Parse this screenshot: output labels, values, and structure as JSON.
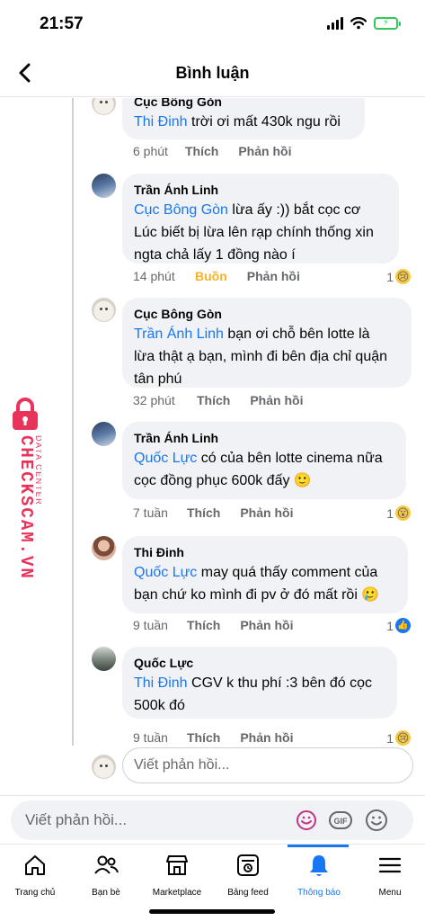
{
  "status_bar": {
    "time": "21:57"
  },
  "header": {
    "title": "Bình luận"
  },
  "comments": [
    {
      "author": "Cục Bông Gòn",
      "mention": "Thi Đinh",
      "lines": [
        " trời ơi mất 430k ngu rồi"
      ],
      "time": "6 phút",
      "reaction_label": "Thích",
      "reply_label": "Phản hồi"
    },
    {
      "author": "Trần Ánh Linh",
      "mention": "Cục Bông Gòn",
      "lines": [
        " lừa ấy :)) bắt cọc cơ",
        "Lúc biết bị lừa lên rạp chính thống xin",
        "ngta chả lấy 1 đồng nào í"
      ],
      "time": "14 phút",
      "reaction_label": "Buồn",
      "reply_label": "Phản hồi",
      "reaction_count": "1",
      "reaction_icon": "sad-emoji-icon"
    },
    {
      "author": "Cục Bông Gòn",
      "mention": "Trần Ánh Linh",
      "lines": [
        " bạn ơi chỗ bên lotte là",
        "lừa thật ạ bạn, mình đi bên địa chỉ quận",
        "tân phú"
      ],
      "time": "32 phút",
      "reaction_label": "Thích",
      "reply_label": "Phản hồi"
    },
    {
      "author": "Trần Ánh Linh",
      "mention": "Quốc Lực",
      "lines": [
        " có của bên lotte cinema nữa",
        "cọc đồng phục 600k đấy 🙂"
      ],
      "time": "7 tuần",
      "reaction_label": "Thích",
      "reply_label": "Phản hồi",
      "reaction_count": "1",
      "reaction_icon": "wow-emoji-icon"
    },
    {
      "author": "Thi Đinh",
      "mention": "Quốc Lực",
      "lines": [
        " may quá thấy comment của",
        "bạn chứ ko mình đi pv ở đó mất rồi 🥲"
      ],
      "time": "9 tuần",
      "reaction_label": "Thích",
      "reply_label": "Phản hồi",
      "reaction_count": "1",
      "reaction_icon": "like-icon"
    },
    {
      "author": "Quốc Lực",
      "mention": "Thi Đinh",
      "lines": [
        " CGV k thu phí :3 bên đó cọc",
        "500k đó"
      ],
      "time": "9 tuần",
      "reaction_label": "Thích",
      "reply_label": "Phản hồi",
      "reaction_count": "1",
      "reaction_icon": "sad-emoji-icon"
    }
  ],
  "inline_reply": {
    "placeholder": "Viết phản hồi..."
  },
  "composer": {
    "placeholder": "Viết phản hồi...",
    "gif_label": "GIF"
  },
  "watermark": {
    "brand": "CHECKSCAM.VN",
    "sub": "DATA CENTER"
  },
  "tabs": [
    {
      "label": "Trang chủ",
      "icon": "home-icon"
    },
    {
      "label": "Bạn bè",
      "icon": "friends-icon"
    },
    {
      "label": "Marketplace",
      "icon": "marketplace-icon"
    },
    {
      "label": "Bảng feed",
      "icon": "feed-icon"
    },
    {
      "label": "Thông báo",
      "icon": "bell-icon",
      "active": true
    },
    {
      "label": "Menu",
      "icon": "menu-icon"
    }
  ],
  "colors": {
    "accent": "#1877f2",
    "bubble": "#f0f2f5",
    "muted": "#65676b",
    "sad_reaction": "#f7b125",
    "watermark": "#e8345a"
  }
}
